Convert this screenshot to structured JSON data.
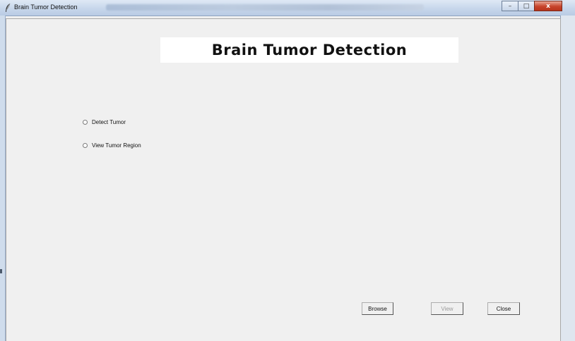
{
  "window": {
    "title": "Brain Tumor Detection",
    "minimize_glyph": "–",
    "maximize_glyph": "□",
    "close_glyph": "x"
  },
  "header": {
    "banner": "Brain Tumor Detection"
  },
  "options": [
    {
      "label": "Detect Tumor",
      "selected": false
    },
    {
      "label": "View Tumor Region",
      "selected": false
    }
  ],
  "buttons": {
    "browse": "Browse",
    "view": "View",
    "close": "Close"
  },
  "colors": {
    "background": "#f0f0f0",
    "banner_bg": "#ffffff"
  }
}
